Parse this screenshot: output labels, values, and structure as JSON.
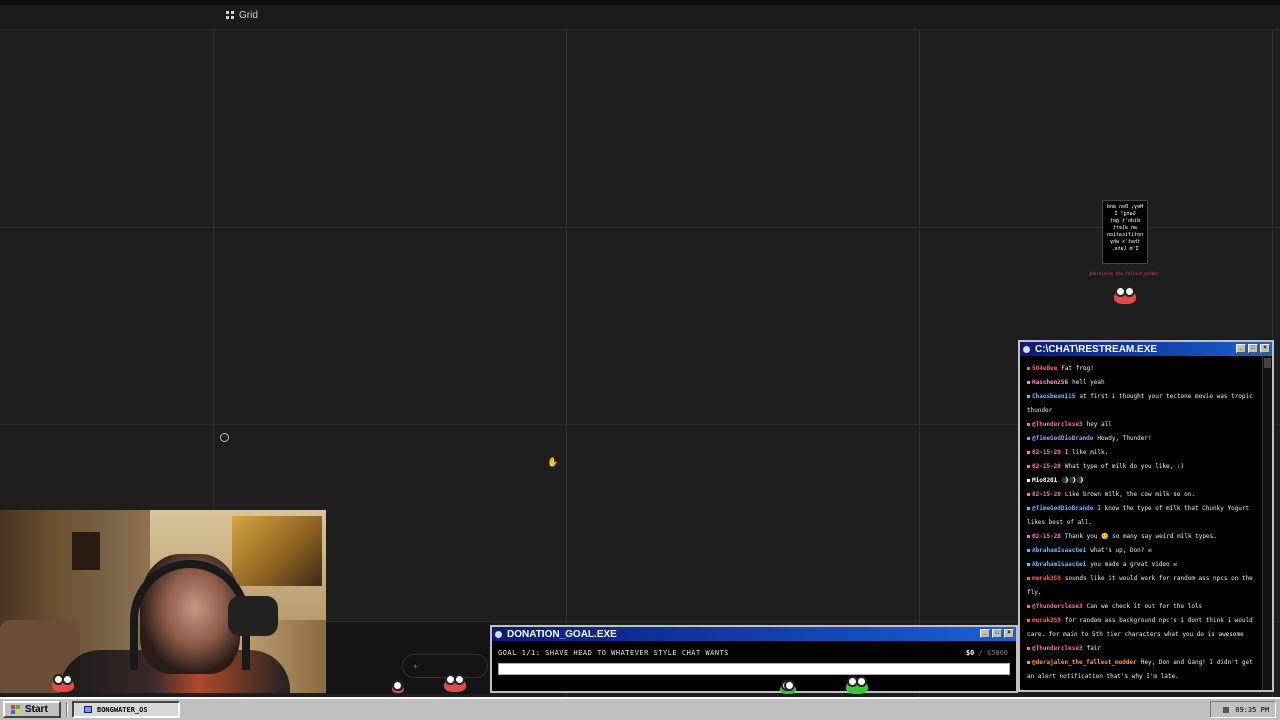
{
  "toolbar": {
    "grid_label": "Grid"
  },
  "overlay": {
    "bubble_text": "Hey, Don and Gang! I didn't get an alert notification that's why I'm late.",
    "bubble_user": "@derajalen_the_fallout_modder"
  },
  "chat": {
    "title": "C:\\CHAT\\RESTREAM.EXE",
    "messages": [
      {
        "user": "504eBee",
        "color": "#ff5a5a",
        "text": "Fat frog!"
      },
      {
        "user": "Haschen256",
        "color": "#ff8ad8",
        "text": "hell yeah"
      },
      {
        "user": "Chaosbean115",
        "color": "#6ab8ff",
        "text": "at first i thought your tectone movie was tropic thunder"
      },
      {
        "user": "@Thunderclese3",
        "color": "#ff6a8a",
        "text": "hey all"
      },
      {
        "user": "@TimeGodDioBrando",
        "color": "#7aa8ff",
        "text": "Howdy, Thunder!"
      },
      {
        "user": "02-15-20",
        "color": "#ff6ad0",
        "text": "I like milk."
      },
      {
        "user": "02-15-20",
        "color": "#ff6ad0",
        "text": "What type of milk do you like, :)"
      },
      {
        "user": "Mio8201",
        "color": "#ffffff",
        "text": "🌒🌒🌒"
      },
      {
        "user": "02-15-20",
        "color": "#ff6ad0",
        "text": "Like brown milk, the cow milk so on."
      },
      {
        "user": "@TimeGodDioBrando",
        "color": "#7aa8ff",
        "text": "I know the type of milk that Chunky Yogurt likes best of all."
      },
      {
        "user": "02-15-20",
        "color": "#ff6ad0",
        "text": "Thank you 🙂 so many say weird milk types."
      },
      {
        "user": "AbrahamIsaacGei",
        "color": "#6ab8ff",
        "text": "what's up, Don? ✉"
      },
      {
        "user": "AbrahamIsaacGei",
        "color": "#6ab8ff",
        "text": "you made a great video ✉"
      },
      {
        "user": "merak359",
        "color": "#ff5a5a",
        "text": "sounds like it would work for random ass npcs on the fly."
      },
      {
        "user": "@Thunderclese3",
        "color": "#ff6a8a",
        "text": "Can we check it out for the lols"
      },
      {
        "user": "merak359",
        "color": "#ff5a5a",
        "text": "for random ass background npc's i dont think i would care. for main to 5th tier characters what you do is awesome"
      },
      {
        "user": "@Thunderclese3",
        "color": "#ff6a8a",
        "text": "fair"
      },
      {
        "user": "@derajalen_the_fallout_modder",
        "color": "#ff9a3a",
        "text": "Hey, Don and Gang! I didn't get an alert notification that's why I'm late."
      }
    ]
  },
  "donation": {
    "title": "DONATION_GOAL.EXE",
    "goal_text": "GOAL 1/1: SHAVE HEAD TO WHATEVER STYLE CHAT WANTS",
    "current": "$0",
    "target": "$5000",
    "progress": 0
  },
  "taskbar": {
    "start_label": "Start",
    "task_label": "BONGWATER_OS",
    "clock": "09:35 PM"
  }
}
